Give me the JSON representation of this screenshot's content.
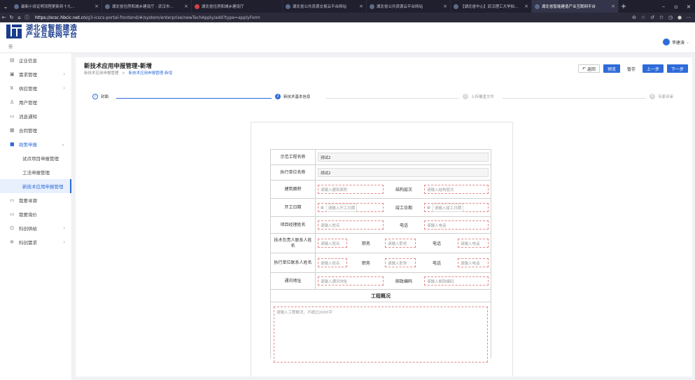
{
  "browser": {
    "tabs": [
      {
        "label": "最新小说证明流程更新到十九…",
        "active": false,
        "favicon": "site"
      },
      {
        "label": "湖北省住房和城乡建设厅 - 武汉市…",
        "active": false,
        "favicon": "globe"
      },
      {
        "label": "湖北省住房和城乡建设厅",
        "active": false,
        "favicon": "red"
      },
      {
        "label": "湖北省公共资源交易云平台网站",
        "active": false,
        "favicon": "globe"
      },
      {
        "label": "湖北省公共资源云平台网站",
        "active": false,
        "favicon": "globe"
      },
      {
        "label": "【湖北省中心】武汉理工大学拍…",
        "active": false,
        "favicon": "globe"
      },
      {
        "label": "湖北省智能建造产业互联网平台",
        "active": true,
        "favicon": "globe"
      }
    ],
    "url_host": "https://scsc.hbcic.net.cn",
    "url_path": "/g3-icscs-portal-frontend/#/system/enterprise/newTechApply/add?type=applyForm"
  },
  "header": {
    "logo_line1": "湖北省智能建造",
    "logo_line2": "产业互联网平台",
    "user_name": "李建涛"
  },
  "sidebar": {
    "items": [
      {
        "label": "企业信息",
        "icon": "building-icon",
        "arrow": false
      },
      {
        "label": "需求管理",
        "icon": "list-icon",
        "arrow": true
      },
      {
        "label": "供应管理",
        "icon": "truck-icon",
        "arrow": true
      },
      {
        "label": "用户管理",
        "icon": "user-icon",
        "arrow": false
      },
      {
        "label": "消息通知",
        "icon": "message-icon",
        "arrow": false
      },
      {
        "label": "合同管理",
        "icon": "contract-icon",
        "arrow": false
      },
      {
        "label": "政策申报",
        "icon": "policy-icon",
        "arrow": true,
        "open": true
      }
    ],
    "subitems": [
      {
        "label": "试点项目申报管理",
        "active": false
      },
      {
        "label": "工法申报管理",
        "active": false
      },
      {
        "label": "新技术应用申报管理",
        "active": true
      }
    ],
    "items2": [
      {
        "label": "我要寻源",
        "icon": "search-source-icon",
        "arrow": false
      },
      {
        "label": "我要询价",
        "icon": "inquiry-icon",
        "arrow": false
      },
      {
        "label": "科创供给",
        "icon": "supply-icon",
        "arrow": true
      },
      {
        "label": "科创需求",
        "icon": "demand-icon",
        "arrow": true
      }
    ]
  },
  "page": {
    "title": "新技术应用申报管理-新增",
    "crumb_parent": "新技术应用申报管理",
    "crumb_sep": ">",
    "crumb_current": "新技术应用申报管理-新增",
    "actions": {
      "back": "返回",
      "preview": "预览",
      "save_draft": "暂存",
      "prev": "上一步",
      "next": "下一步"
    },
    "steps": [
      {
        "num": "✓",
        "label": "封面",
        "state": "done"
      },
      {
        "num": "2",
        "label": "新技术基本信息",
        "state": "current"
      },
      {
        "num": "3",
        "label": "上传覆盖文件",
        "state": "todo"
      },
      {
        "num": "4",
        "label": "专家评审",
        "state": "todo"
      }
    ]
  },
  "form": {
    "demo_project_label": "示范工程名称",
    "demo_project_value": "测试2",
    "exec_unit_label": "执行单位名称",
    "exec_unit_value": "测试2",
    "area_label": "建筑面积",
    "area_placeholder": "请输入建筑面积",
    "structure_label": "结构层次",
    "structure_placeholder": "请输入结构层次",
    "start_label": "开工日期",
    "start_placeholder": "请输入开工日期",
    "end_label": "竣工日期",
    "end_placeholder": "请输入竣工日期",
    "pm_label": "项目经理姓名",
    "pm_placeholder": "请输入姓名",
    "phone_label": "电话",
    "phone_placeholder": "请输入电话",
    "tech_contact_label": "技术负责人联系人姓名",
    "tech_name_placeholder": "请输入姓名",
    "duty_label": "职务",
    "duty_placeholder": "请输入职务",
    "tech_phone_label": "电话",
    "tech_phone_placeholder": "请输入电话",
    "exec_contact_label": "执行单位联系人姓名",
    "exec_name_placeholder": "请输入姓名",
    "exec_duty_label": "职务",
    "exec_duty_placeholder": "请输入职务",
    "exec_phone_label": "电话",
    "exec_phone_placeholder": "请输入电话",
    "address_label": "通讯地址",
    "address_placeholder": "请输入通讯地址",
    "postcode_label": "邮政编码",
    "postcode_placeholder": "请输入邮政编码",
    "overview_title": "工程概况",
    "overview_placeholder": "请输入工程概况，不超过2000字"
  }
}
